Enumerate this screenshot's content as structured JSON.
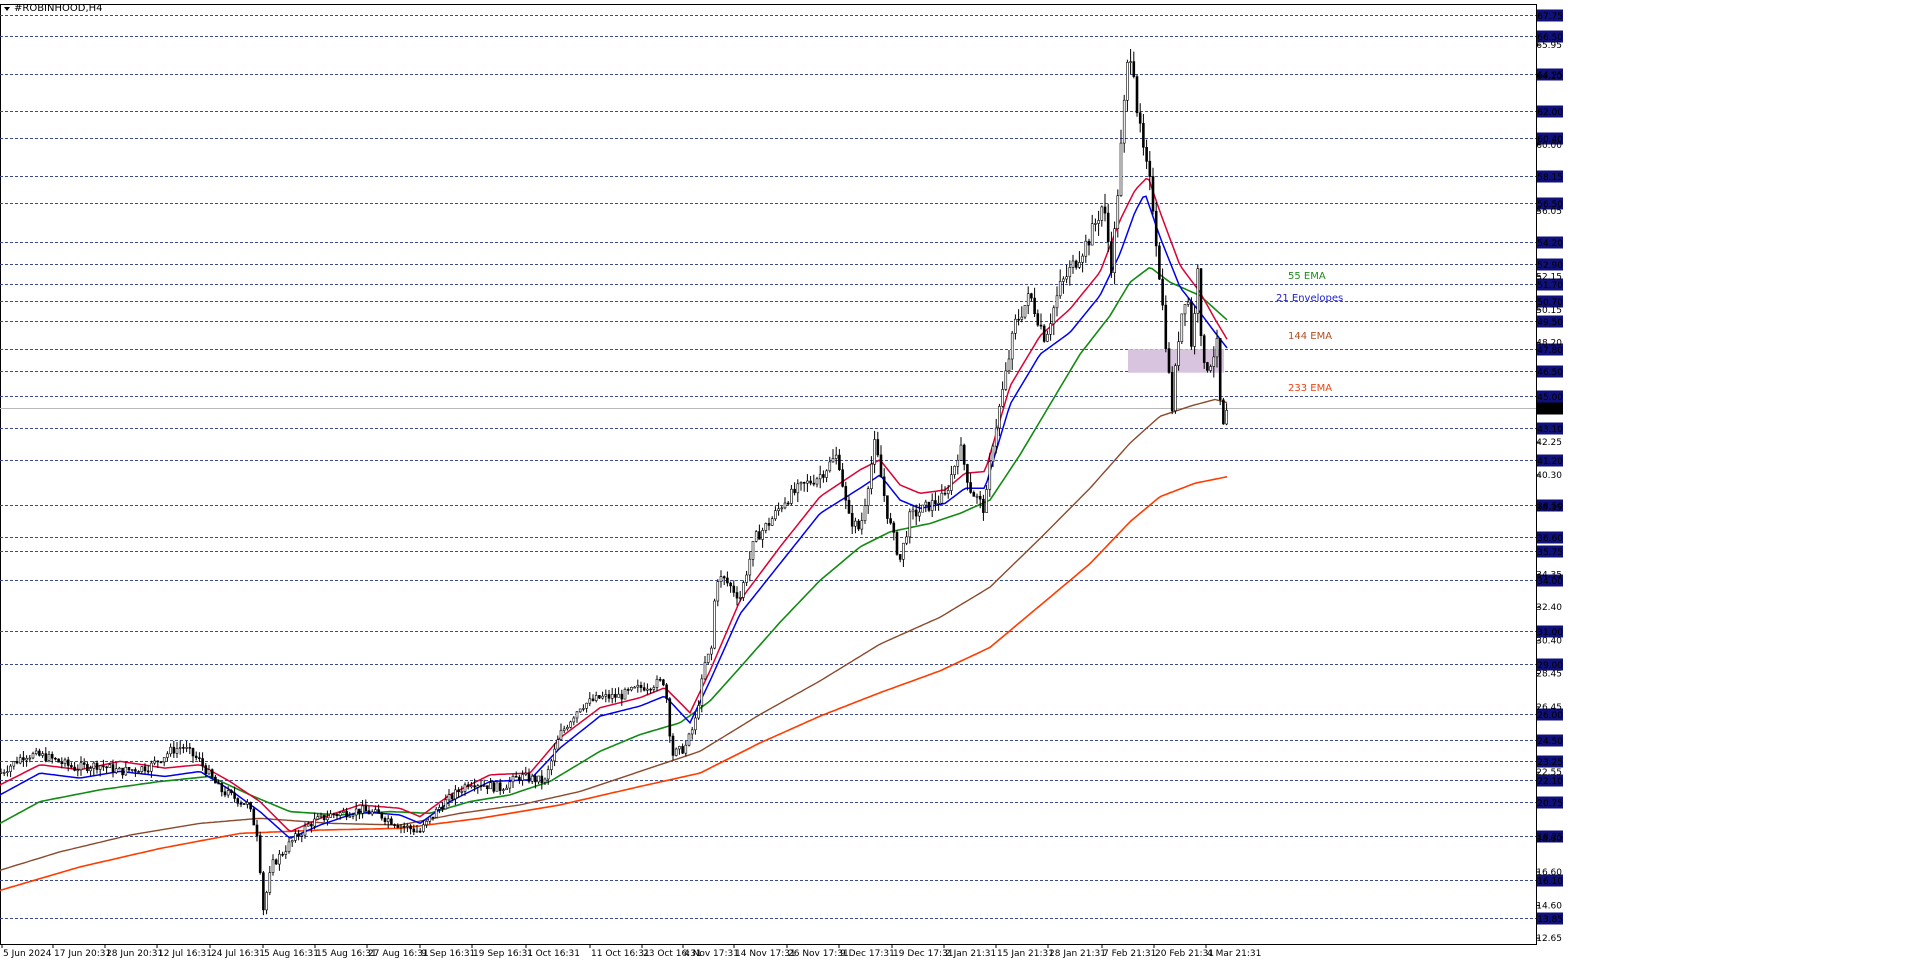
{
  "window": {
    "title": "#ROBINHOOD,H4"
  },
  "chart_data": {
    "type": "candlestick",
    "symbol": "#ROBINHOOD",
    "timeframe": "H4",
    "ylim": [
      12.0,
      68.5
    ],
    "grid": true,
    "current_price": "44.27",
    "x_ticks": [
      "5 Jun 2024",
      "17 Jun 20:31",
      "28 Jun 20:31",
      "12 Jul 16:31",
      "24 Jul 16:31",
      "5 Aug 16:31",
      "15 Aug 16:31",
      "27 Aug 16:31",
      "9 Sep 16:31",
      "19 Sep 16:31",
      "1 Oct 16:31",
      "11 Oct 16:31",
      "23 Oct 16:31",
      "4 Nov 17:31",
      "14 Nov 17:31",
      "26 Nov 17:31",
      "9 Dec 17:31",
      "19 Dec 17:31",
      "2 Jan 21:31",
      "15 Jan 21:31",
      "28 Jan 21:31",
      "7 Feb 21:31",
      "20 Feb 21:31",
      "4 Mar 21:31"
    ],
    "grid_levels": [
      "67.75",
      "66.50",
      "64.25",
      "62.00",
      "60.40",
      "58.15",
      "56.50",
      "54.20",
      "52.90",
      "51.70",
      "50.70",
      "49.50",
      "47.80",
      "46.50",
      "45.00",
      "43.10",
      "41.20",
      "38.50",
      "36.60",
      "35.75",
      "34.00",
      "31.00",
      "29.00",
      "26.00",
      "24.50",
      "23.25",
      "22.10",
      "20.75",
      "18.75",
      "16.10",
      "13.85"
    ],
    "minor_levels": [
      "65.95",
      "64.10",
      "60.00",
      "56.05",
      "52.15",
      "50.15",
      "48.20",
      "42.25",
      "40.30",
      "38.35",
      "34.35",
      "32.40",
      "30.40",
      "28.45",
      "26.45",
      "22.55",
      "18.60",
      "16.60",
      "14.60",
      "12.65"
    ],
    "zone": {
      "from": 46.4,
      "to": 47.8,
      "color": "#d8c4de"
    },
    "indicators": [
      {
        "name": "55 EMA",
        "color": "#1e8c1e"
      },
      {
        "name": "21 Envelopes",
        "color": "#2222cc"
      },
      {
        "name": "144 EMA",
        "color": "#b04e20"
      },
      {
        "name": "233 EMA",
        "color": "#ee4411"
      }
    ],
    "envelope_lower_color": "#0000ee",
    "envelope_upper_color": "#dd0033",
    "ema144_color": "#8b4a2e",
    "ema233_color": "#ff3c00",
    "ema55_color": "#138a13",
    "price_anchors": [
      [
        0,
        22.5
      ],
      [
        25,
        23.6
      ],
      [
        45,
        23.5
      ],
      [
        75,
        22.8
      ],
      [
        98,
        23.0
      ],
      [
        120,
        22.6
      ],
      [
        150,
        22.9
      ],
      [
        170,
        23.8
      ],
      [
        182,
        24.1
      ],
      [
        200,
        23.2
      ],
      [
        220,
        21.5
      ],
      [
        248,
        20.6
      ],
      [
        258,
        18.8
      ],
      [
        263,
        14.3
      ],
      [
        272,
        17.0
      ],
      [
        290,
        18.3
      ],
      [
        310,
        19.5
      ],
      [
        330,
        20.0
      ],
      [
        360,
        20.3
      ],
      [
        380,
        20.0
      ],
      [
        400,
        19.4
      ],
      [
        420,
        19.0
      ],
      [
        440,
        20.5
      ],
      [
        470,
        22.0
      ],
      [
        500,
        21.6
      ],
      [
        520,
        22.3
      ],
      [
        545,
        22.0
      ],
      [
        560,
        24.8
      ],
      [
        580,
        26.5
      ],
      [
        600,
        27.0
      ],
      [
        620,
        27.1
      ],
      [
        640,
        27.6
      ],
      [
        665,
        28.0
      ],
      [
        672,
        23.6
      ],
      [
        685,
        24.0
      ],
      [
        695,
        25.5
      ],
      [
        705,
        29.0
      ],
      [
        712,
        30.0
      ],
      [
        716,
        34.2
      ],
      [
        725,
        34.0
      ],
      [
        740,
        33.0
      ],
      [
        755,
        36.5
      ],
      [
        770,
        37.5
      ],
      [
        785,
        38.8
      ],
      [
        800,
        39.5
      ],
      [
        820,
        40.3
      ],
      [
        838,
        41.5
      ],
      [
        848,
        37.8
      ],
      [
        860,
        37.0
      ],
      [
        875,
        42.2
      ],
      [
        888,
        37.8
      ],
      [
        900,
        35.2
      ],
      [
        910,
        37.8
      ],
      [
        930,
        38.5
      ],
      [
        945,
        39.0
      ],
      [
        960,
        42.0
      ],
      [
        970,
        39.5
      ],
      [
        985,
        38.2
      ],
      [
        992,
        42.0
      ],
      [
        1005,
        46.0
      ],
      [
        1015,
        49.3
      ],
      [
        1030,
        51.0
      ],
      [
        1045,
        48.5
      ],
      [
        1060,
        51.5
      ],
      [
        1075,
        53.0
      ],
      [
        1090,
        54.5
      ],
      [
        1103,
        56.5
      ],
      [
        1112,
        52.6
      ],
      [
        1120,
        59.0
      ],
      [
        1127,
        64.5
      ],
      [
        1132,
        66.0
      ],
      [
        1138,
        61.5
      ],
      [
        1145,
        59.0
      ],
      [
        1152,
        57.0
      ],
      [
        1160,
        52.0
      ],
      [
        1167,
        47.5
      ],
      [
        1172,
        44.2
      ],
      [
        1180,
        49.5
      ],
      [
        1187,
        51.5
      ],
      [
        1193,
        47.0
      ],
      [
        1197,
        54.0
      ],
      [
        1203,
        46.5
      ],
      [
        1210,
        47.0
      ],
      [
        1217,
        48.0
      ],
      [
        1222,
        42.7
      ],
      [
        1228,
        44.3
      ]
    ],
    "ema_lower_anchors": [
      [
        0,
        21.2
      ],
      [
        40,
        22.5
      ],
      [
        80,
        22.2
      ],
      [
        120,
        22.6
      ],
      [
        165,
        22.3
      ],
      [
        200,
        22.6
      ],
      [
        230,
        21.5
      ],
      [
        260,
        20.2
      ],
      [
        290,
        18.6
      ],
      [
        320,
        19.4
      ],
      [
        360,
        20.2
      ],
      [
        400,
        20.0
      ],
      [
        420,
        19.5
      ],
      [
        450,
        20.8
      ],
      [
        490,
        22.0
      ],
      [
        530,
        22.1
      ],
      [
        560,
        24.0
      ],
      [
        600,
        25.9
      ],
      [
        640,
        26.5
      ],
      [
        665,
        27.1
      ],
      [
        690,
        25.5
      ],
      [
        710,
        28.0
      ],
      [
        740,
        32.0
      ],
      [
        780,
        35.0
      ],
      [
        820,
        38.0
      ],
      [
        860,
        39.5
      ],
      [
        880,
        40.3
      ],
      [
        900,
        38.8
      ],
      [
        920,
        38.3
      ],
      [
        945,
        38.6
      ],
      [
        965,
        39.5
      ],
      [
        985,
        39.5
      ],
      [
        1010,
        44.5
      ],
      [
        1040,
        47.5
      ],
      [
        1070,
        48.8
      ],
      [
        1100,
        51.0
      ],
      [
        1120,
        53.5
      ],
      [
        1135,
        56.0
      ],
      [
        1145,
        57.1
      ],
      [
        1160,
        54.5
      ],
      [
        1180,
        51.5
      ],
      [
        1200,
        50.0
      ],
      [
        1215,
        48.8
      ],
      [
        1228,
        47.8
      ]
    ],
    "ema_upper_anchors": [
      [
        0,
        21.8
      ],
      [
        40,
        23.0
      ],
      [
        80,
        22.7
      ],
      [
        120,
        23.2
      ],
      [
        165,
        22.8
      ],
      [
        200,
        23.0
      ],
      [
        230,
        22.0
      ],
      [
        260,
        20.8
      ],
      [
        290,
        19.0
      ],
      [
        320,
        19.8
      ],
      [
        360,
        20.6
      ],
      [
        400,
        20.4
      ],
      [
        420,
        19.9
      ],
      [
        450,
        21.2
      ],
      [
        490,
        22.4
      ],
      [
        530,
        22.5
      ],
      [
        560,
        24.6
      ],
      [
        600,
        26.4
      ],
      [
        640,
        27.0
      ],
      [
        665,
        27.6
      ],
      [
        690,
        26.1
      ],
      [
        710,
        28.6
      ],
      [
        740,
        32.8
      ],
      [
        780,
        36.0
      ],
      [
        820,
        39.0
      ],
      [
        860,
        40.6
      ],
      [
        880,
        41.2
      ],
      [
        900,
        39.7
      ],
      [
        920,
        39.2
      ],
      [
        945,
        39.4
      ],
      [
        965,
        40.4
      ],
      [
        985,
        40.5
      ],
      [
        1010,
        45.6
      ],
      [
        1040,
        48.6
      ],
      [
        1070,
        50.2
      ],
      [
        1100,
        52.4
      ],
      [
        1120,
        55.5
      ],
      [
        1135,
        57.3
      ],
      [
        1148,
        58.1
      ],
      [
        1160,
        56.0
      ],
      [
        1180,
        52.8
      ],
      [
        1200,
        51.2
      ],
      [
        1215,
        49.6
      ],
      [
        1228,
        48.3
      ]
    ],
    "ema55_anchors": [
      [
        0,
        19.5
      ],
      [
        40,
        20.8
      ],
      [
        100,
        21.5
      ],
      [
        160,
        22.0
      ],
      [
        210,
        22.3
      ],
      [
        250,
        21.2
      ],
      [
        290,
        20.2
      ],
      [
        340,
        20.0
      ],
      [
        390,
        20.2
      ],
      [
        430,
        20.1
      ],
      [
        470,
        20.8
      ],
      [
        510,
        21.2
      ],
      [
        550,
        22.0
      ],
      [
        600,
        23.8
      ],
      [
        640,
        24.8
      ],
      [
        680,
        25.5
      ],
      [
        710,
        26.8
      ],
      [
        740,
        28.8
      ],
      [
        780,
        31.5
      ],
      [
        820,
        34.0
      ],
      [
        860,
        36.0
      ],
      [
        890,
        36.9
      ],
      [
        930,
        37.4
      ],
      [
        960,
        38.0
      ],
      [
        990,
        38.8
      ],
      [
        1020,
        41.5
      ],
      [
        1050,
        44.5
      ],
      [
        1080,
        47.5
      ],
      [
        1110,
        49.8
      ],
      [
        1130,
        51.8
      ],
      [
        1150,
        52.7
      ],
      [
        1170,
        51.8
      ],
      [
        1200,
        51.0
      ],
      [
        1228,
        49.5
      ]
    ],
    "ema144_anchors": [
      [
        0,
        16.7
      ],
      [
        60,
        17.8
      ],
      [
        130,
        18.8
      ],
      [
        200,
        19.5
      ],
      [
        260,
        19.8
      ],
      [
        330,
        19.5
      ],
      [
        400,
        19.4
      ],
      [
        460,
        20.1
      ],
      [
        520,
        20.6
      ],
      [
        580,
        21.4
      ],
      [
        640,
        22.6
      ],
      [
        700,
        23.8
      ],
      [
        760,
        26.0
      ],
      [
        820,
        28.0
      ],
      [
        880,
        30.2
      ],
      [
        940,
        31.8
      ],
      [
        990,
        33.6
      ],
      [
        1040,
        36.5
      ],
      [
        1090,
        39.5
      ],
      [
        1130,
        42.2
      ],
      [
        1160,
        43.8
      ],
      [
        1190,
        44.4
      ],
      [
        1215,
        44.8
      ],
      [
        1228,
        44.6
      ]
    ],
    "ema233_anchors": [
      [
        0,
        15.5
      ],
      [
        80,
        16.9
      ],
      [
        160,
        18.0
      ],
      [
        240,
        18.9
      ],
      [
        320,
        19.1
      ],
      [
        400,
        19.2
      ],
      [
        480,
        19.8
      ],
      [
        560,
        20.6
      ],
      [
        640,
        21.7
      ],
      [
        700,
        22.5
      ],
      [
        760,
        24.3
      ],
      [
        820,
        25.9
      ],
      [
        880,
        27.3
      ],
      [
        940,
        28.6
      ],
      [
        990,
        30.0
      ],
      [
        1040,
        32.5
      ],
      [
        1090,
        35.0
      ],
      [
        1130,
        37.5
      ],
      [
        1160,
        39.0
      ],
      [
        1195,
        39.8
      ],
      [
        1228,
        40.2
      ]
    ]
  }
}
